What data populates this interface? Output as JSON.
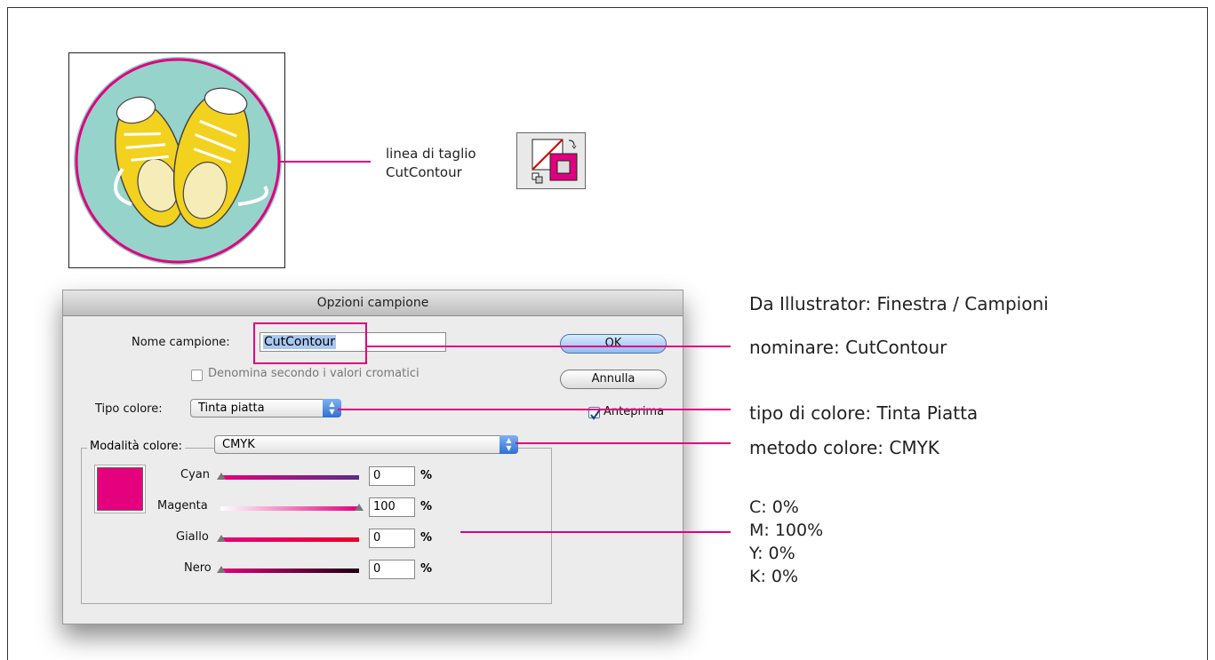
{
  "art": {
    "label_lines": [
      "linea di taglio",
      "CutContour"
    ]
  },
  "annotations": {
    "source": "Da Illustrator: Finestra / Campioni",
    "name": "nominare: CutContour",
    "type": "tipo di colore: Tinta Piatta",
    "mode": "metodo colore: CMYK",
    "cmyk_values": [
      "C: 0%",
      "M: 100%",
      "Y: 0%",
      "K: 0%"
    ]
  },
  "dialog": {
    "title": "Opzioni campione",
    "name_label": "Nome campione:",
    "name_value": "CutContour",
    "checkbox_label": "Denomina secondo i valori cromatici",
    "type_label": "Tipo colore:",
    "type_value": "Tinta piatta",
    "mode_label": "Modalità colore:",
    "mode_value": "CMYK",
    "ok": "OK",
    "cancel": "Annulla",
    "preview": "Anteprima",
    "percent": "%",
    "swatch_color": "#e5007e",
    "channels": [
      {
        "name": "Cyan",
        "value": "0"
      },
      {
        "name": "Magenta",
        "value": "100"
      },
      {
        "name": "Giallo",
        "value": "0"
      },
      {
        "name": "Nero",
        "value": "0"
      }
    ]
  },
  "colors": {
    "cut_line": "#e0007f",
    "badge_teal": "#96d3cb",
    "shoe_yellow": "#f2d21e"
  }
}
